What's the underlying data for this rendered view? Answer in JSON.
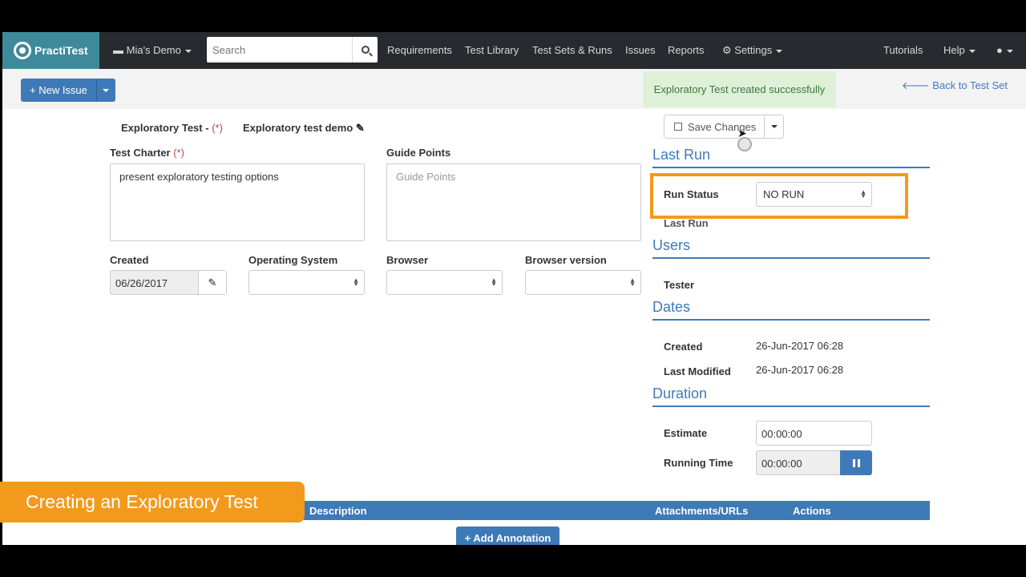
{
  "navbar": {
    "brand": "PractiTest",
    "project": "Mia's Demo",
    "search_placeholder": "Search",
    "links": [
      "Requirements",
      "Test Library",
      "Test Sets & Runs",
      "Issues",
      "Reports"
    ],
    "settings": "Settings",
    "tutorials": "Tutorials",
    "help": "Help"
  },
  "toolbar": {
    "new_issue": "+ New Issue",
    "alert": "Exploratory Test created successfully",
    "back": "Back to Test Set"
  },
  "test": {
    "type_label": "Exploratory Test - ",
    "required_mark": "(*)",
    "name": "Exploratory test demo"
  },
  "form": {
    "charter_label": "Test Charter ",
    "charter_value": "present exploratory testing options",
    "guide_label": "Guide Points",
    "guide_placeholder": "Guide Points",
    "created_label": "Created",
    "created_value": "06/26/2017",
    "os_label": "Operating System",
    "browser_label": "Browser",
    "browser_version_label": "Browser version"
  },
  "save": {
    "label": "Save Changes"
  },
  "last_run": {
    "title": "Last Run",
    "run_status_label": "Run Status",
    "run_status_value": "NO RUN",
    "last_run_label": "Last Run"
  },
  "users": {
    "title": "Users",
    "tester_label": "Tester"
  },
  "dates": {
    "title": "Dates",
    "created_label": "Created",
    "created_value": "26-Jun-2017 06:28",
    "modified_label": "Last Modified",
    "modified_value": "26-Jun-2017 06:28"
  },
  "duration": {
    "title": "Duration",
    "estimate_label": "Estimate",
    "estimate_value": "00:00:00",
    "running_label": "Running Time",
    "running_value": "00:00:00"
  },
  "annotations": {
    "columns": [
      "Description",
      "Attachments/URLs",
      "Actions"
    ],
    "add_label": "+ Add Annotation"
  },
  "overlay": {
    "caption": "Creating an Exploratory Test"
  },
  "colors": {
    "accent": "#3f7ab8",
    "highlight": "#f39a1c",
    "brand": "#3e8a9b"
  }
}
